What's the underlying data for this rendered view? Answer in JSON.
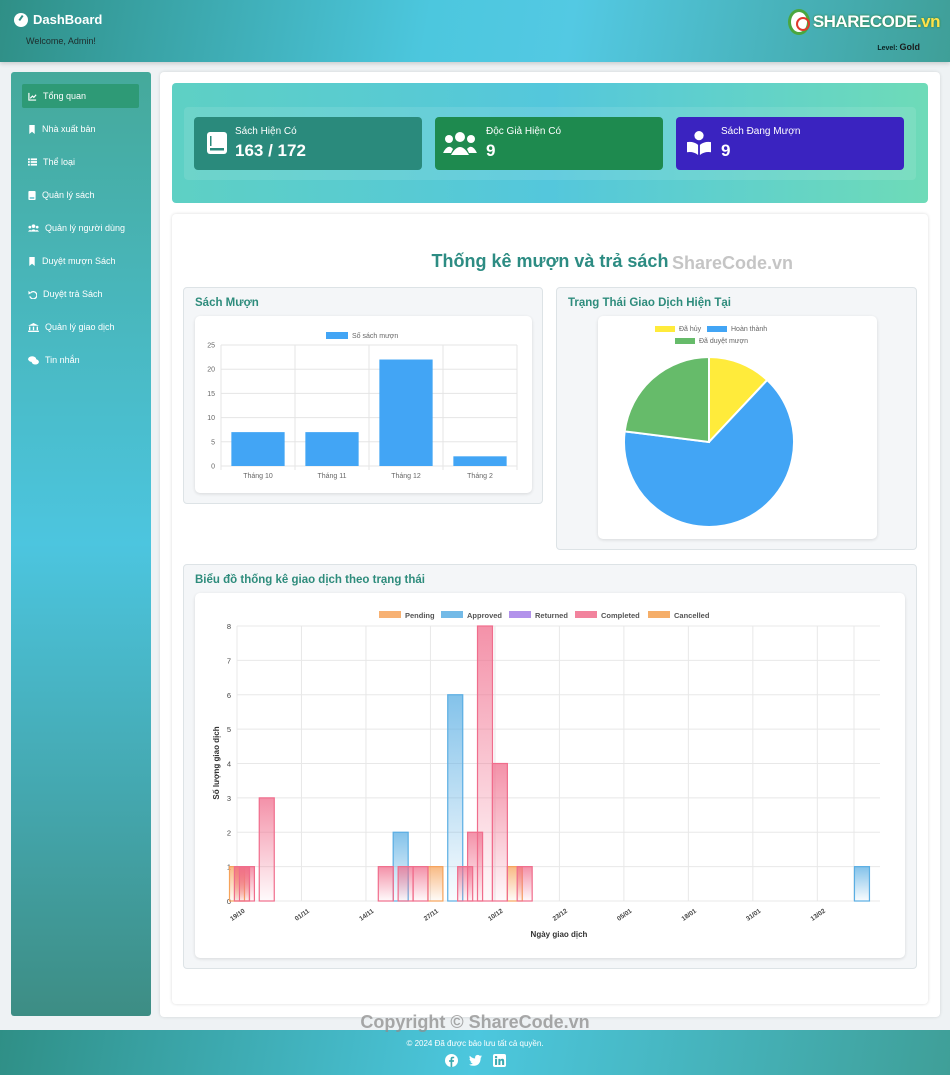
{
  "header": {
    "title": "DashBoard",
    "welcome": "Welcome, Admin!",
    "logo_text_main": "SHARECODE",
    "logo_text_suffix": ".vn",
    "level_label": "Level:",
    "level_value": "Gold"
  },
  "sidebar": {
    "items": [
      {
        "label": "Tổng quan",
        "icon": "chart-line-icon",
        "active": true
      },
      {
        "label": "Nhà xuất bản",
        "icon": "bookmark-icon"
      },
      {
        "label": "Thể loại",
        "icon": "list-icon"
      },
      {
        "label": "Quản lý sách",
        "icon": "book-icon"
      },
      {
        "label": "Quản lý người dùng",
        "icon": "users-icon"
      },
      {
        "label": "Duyệt mượn Sách",
        "icon": "bookmark-icon"
      },
      {
        "label": "Duyệt trả Sách",
        "icon": "undo-icon"
      },
      {
        "label": "Quản lý giao dịch",
        "icon": "bank-icon"
      },
      {
        "label": "Tin nhắn",
        "icon": "comments-icon"
      }
    ]
  },
  "stats": [
    {
      "label": "Sách Hiện Có",
      "value": "163 / 172",
      "color": "#2a8a7c",
      "icon": "book-icon"
    },
    {
      "label": "Độc Giả Hiện Có",
      "value": "9",
      "color": "#1e8a4f",
      "icon": "users-icon"
    },
    {
      "label": "Sách Đang Mượn",
      "value": "9",
      "color": "#3a23c0",
      "icon": "reader-icon"
    }
  ],
  "charts_section": {
    "title": "Thống kê mượn và trả sách",
    "watermark": "ShareCode.vn"
  },
  "panels": {
    "borrow_title": "Sách Mượn",
    "status_title": "Trạng Thái Giao Dịch Hiện Tại",
    "timeline_title": "Biểu đồ thống kê giao dịch theo trạng thái"
  },
  "chart_data": [
    {
      "type": "bar",
      "legend": [
        "Số sách mượn"
      ],
      "categories": [
        "Tháng 10",
        "Tháng 11",
        "Tháng 12",
        "Tháng 2"
      ],
      "series": [
        {
          "name": "Số sách mượn",
          "values": [
            7,
            7,
            22,
            2
          ]
        }
      ],
      "ylim": [
        0,
        25
      ],
      "yticks": [
        0,
        5,
        10,
        15,
        20,
        25
      ],
      "colors": [
        "#42a5f5"
      ],
      "grid": true,
      "legend_position": "top"
    },
    {
      "type": "pie",
      "labels": [
        "Đã hủy",
        "Hoàn thành",
        "Đã duyệt mượn"
      ],
      "values": [
        12,
        65,
        23
      ],
      "colors": [
        "#ffeb3b",
        "#42a5f5",
        "#66bb6a"
      ],
      "legend_position": "top"
    },
    {
      "type": "bar",
      "xlabel": "Ngày giao dịch",
      "ylabel": "Số lượng giao dịch",
      "ylim": [
        0,
        8
      ],
      "yticks": [
        0,
        1,
        2,
        3,
        4,
        5,
        6,
        7,
        8
      ],
      "xticks": [
        "19/10",
        "01/11",
        "14/11",
        "27/11",
        "10/12",
        "23/12",
        "05/01",
        "18/01",
        "31/01",
        "13/02"
      ],
      "legend_position": "top",
      "grid": true,
      "series": [
        {
          "name": "Pending",
          "color": "#f6a35b",
          "points": [
            {
              "x": "19/10",
              "y": 1
            },
            {
              "x": "20/10",
              "y": 1
            },
            {
              "x": "28/11",
              "y": 1
            },
            {
              "x": "14/12",
              "y": 1
            }
          ]
        },
        {
          "name": "Approved",
          "color": "#5aaee3",
          "points": [
            {
              "x": "21/11",
              "y": 2
            },
            {
              "x": "02/12",
              "y": 6
            },
            {
              "x": "22/02",
              "y": 1
            }
          ]
        },
        {
          "name": "Returned",
          "color": "#a57fe8",
          "points": []
        },
        {
          "name": "Completed",
          "color": "#f06d8c",
          "points": [
            {
              "x": "20/10",
              "y": 1
            },
            {
              "x": "21/10",
              "y": 1
            },
            {
              "x": "25/10",
              "y": 3
            },
            {
              "x": "18/11",
              "y": 1
            },
            {
              "x": "22/11",
              "y": 1
            },
            {
              "x": "25/11",
              "y": 1
            },
            {
              "x": "04/12",
              "y": 1
            },
            {
              "x": "06/12",
              "y": 2
            },
            {
              "x": "08/12",
              "y": 8
            },
            {
              "x": "11/12",
              "y": 4
            },
            {
              "x": "16/12",
              "y": 1
            }
          ]
        },
        {
          "name": "Cancelled",
          "color": "#f3a04f",
          "points": []
        }
      ]
    }
  ],
  "footer": {
    "copyright": "© 2024 Đã được bảo lưu tất cả quyền.",
    "watermark": "Copyright © ShareCode.vn",
    "social": [
      "facebook-icon",
      "twitter-icon",
      "linkedin-icon"
    ]
  }
}
